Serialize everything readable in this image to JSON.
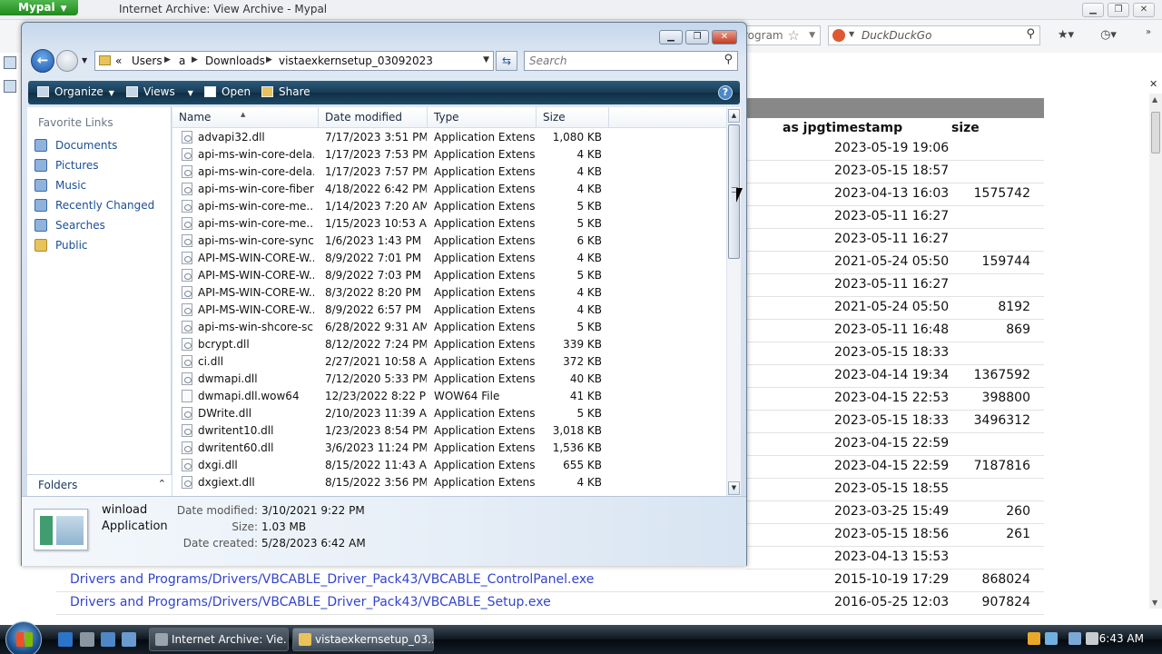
{
  "browser": {
    "app_button": "Mypal",
    "window_title": "Internet Archive: View Archive - Mypal",
    "address_tail": "rogram",
    "search_placeholder": "DuckDuckGo",
    "table": {
      "col_timestamp": "as jpgtimestamp",
      "col_size": "size",
      "rows": [
        {
          "ts": "2023-05-19 19:06",
          "size": ""
        },
        {
          "ts": "2023-05-15 18:57",
          "size": ""
        },
        {
          "ts": "2023-04-13 16:03",
          "size": "1575742"
        },
        {
          "ts": "2023-05-11 16:27",
          "size": ""
        },
        {
          "ts": "2023-05-11 16:27",
          "size": ""
        },
        {
          "ts": "2021-05-24 05:50",
          "size": "159744"
        },
        {
          "ts": "2023-05-11 16:27",
          "size": ""
        },
        {
          "ts": "2021-05-24 05:50",
          "size": "8192"
        },
        {
          "ts": "2023-05-11 16:48",
          "size": "869"
        },
        {
          "ts": "2023-05-15 18:33",
          "size": ""
        },
        {
          "ts": "2023-04-14 19:34",
          "size": "1367592"
        },
        {
          "ts": "2023-04-15 22:53",
          "size": "398800"
        },
        {
          "ts": "2023-05-15 18:33",
          "size": "3496312"
        },
        {
          "ts": "2023-04-15 22:59",
          "size": ""
        },
        {
          "ts": "2023-04-15 22:59",
          "size": "7187816"
        },
        {
          "ts": "2023-05-15 18:55",
          "size": ""
        },
        {
          "ts": "2023-03-25 15:49",
          "size": "260"
        },
        {
          "ts": "2023-05-15 18:56",
          "size": "261"
        },
        {
          "ts": "2023-04-13 15:53",
          "size": ""
        }
      ],
      "wide_rows": [
        {
          "link": "Drivers and Programs/Drivers/VBCABLE_Driver_Pack43/VBCABLE_ControlPanel.exe",
          "ts": "2015-10-19 17:29",
          "size": "868024"
        },
        {
          "link": "Drivers and Programs/Drivers/VBCABLE_Driver_Pack43/VBCABLE_Setup.exe",
          "ts": "2016-05-25 12:03",
          "size": "907824"
        }
      ]
    }
  },
  "explorer": {
    "breadcrumb": [
      "«",
      "Users",
      "a",
      "Downloads",
      "vistaexkernsetup_03092023"
    ],
    "search_placeholder": "Search",
    "commands": {
      "organize": "Organize",
      "views": "Views",
      "open": "Open",
      "share": "Share"
    },
    "help": "?",
    "favorite_links_header": "Favorite Links",
    "favorite_links": [
      "Documents",
      "Pictures",
      "Music",
      "Recently Changed",
      "Searches",
      "Public"
    ],
    "folders_label": "Folders",
    "columns": {
      "name": "Name",
      "modified": "Date modified",
      "type": "Type",
      "size": "Size"
    },
    "files": [
      {
        "name": "advapi32.dll",
        "modified": "7/17/2023 3:51 PM",
        "type": "Application Extens...",
        "size": "1,080 KB"
      },
      {
        "name": "api-ms-win-core-dela...",
        "modified": "1/17/2023 7:53 PM",
        "type": "Application Extens...",
        "size": "4 KB"
      },
      {
        "name": "api-ms-win-core-dela...",
        "modified": "1/17/2023 7:57 PM",
        "type": "Application Extens...",
        "size": "4 KB"
      },
      {
        "name": "api-ms-win-core-fiber...",
        "modified": "4/18/2022 6:42 PM",
        "type": "Application Extens...",
        "size": "4 KB"
      },
      {
        "name": "api-ms-win-core-me...",
        "modified": "1/14/2023 7:20 AM",
        "type": "Application Extens...",
        "size": "5 KB"
      },
      {
        "name": "api-ms-win-core-me...",
        "modified": "1/15/2023 10:53 AM",
        "type": "Application Extens...",
        "size": "5 KB"
      },
      {
        "name": "api-ms-win-core-sync...",
        "modified": "1/6/2023 1:43 PM",
        "type": "Application Extens...",
        "size": "6 KB"
      },
      {
        "name": "API-MS-WIN-CORE-W...",
        "modified": "8/9/2022 7:01 PM",
        "type": "Application Extens...",
        "size": "4 KB"
      },
      {
        "name": "API-MS-WIN-CORE-W...",
        "modified": "8/9/2022 7:03 PM",
        "type": "Application Extens...",
        "size": "5 KB"
      },
      {
        "name": "API-MS-WIN-CORE-W...",
        "modified": "8/3/2022 8:20 PM",
        "type": "Application Extens...",
        "size": "4 KB"
      },
      {
        "name": "API-MS-WIN-CORE-W...",
        "modified": "8/9/2022 6:57 PM",
        "type": "Application Extens...",
        "size": "4 KB"
      },
      {
        "name": "api-ms-win-shcore-sc...",
        "modified": "6/28/2022 9:31 AM",
        "type": "Application Extens...",
        "size": "5 KB"
      },
      {
        "name": "bcrypt.dll",
        "modified": "8/12/2022 7:24 PM",
        "type": "Application Extens...",
        "size": "339 KB"
      },
      {
        "name": "ci.dll",
        "modified": "2/27/2021 10:58 AM",
        "type": "Application Extens...",
        "size": "372 KB"
      },
      {
        "name": "dwmapi.dll",
        "modified": "7/12/2020 5:33 PM",
        "type": "Application Extens...",
        "size": "40 KB"
      },
      {
        "name": "dwmapi.dll.wow64",
        "modified": "12/23/2022 8:22 PM",
        "type": "WOW64 File",
        "size": "41 KB",
        "plain": true
      },
      {
        "name": "DWrite.dll",
        "modified": "2/10/2023 11:39 AM",
        "type": "Application Extens...",
        "size": "5 KB"
      },
      {
        "name": "dwritent10.dll",
        "modified": "1/23/2023 8:54 PM",
        "type": "Application Extens...",
        "size": "3,018 KB"
      },
      {
        "name": "dwritent60.dll",
        "modified": "3/6/2023 11:24 PM",
        "type": "Application Extens...",
        "size": "1,536 KB"
      },
      {
        "name": "dxgi.dll",
        "modified": "8/15/2022 11:43 AM",
        "type": "Application Extens...",
        "size": "655 KB"
      },
      {
        "name": "dxgiext.dll",
        "modified": "8/15/2022 3:56 PM",
        "type": "Application Extens...",
        "size": "4 KB"
      }
    ],
    "details": {
      "name": "winload",
      "type": "Application",
      "modified_label": "Date modified:",
      "modified": "3/10/2021 9:22 PM",
      "size_label": "Size:",
      "size": "1.03 MB",
      "created_label": "Date created:",
      "created": "5/28/2023 6:42 AM"
    }
  },
  "taskbar": {
    "tasks": [
      "Internet Archive: Vie...",
      "vistaexkernsetup_03..."
    ],
    "clock": "6:43 AM"
  }
}
